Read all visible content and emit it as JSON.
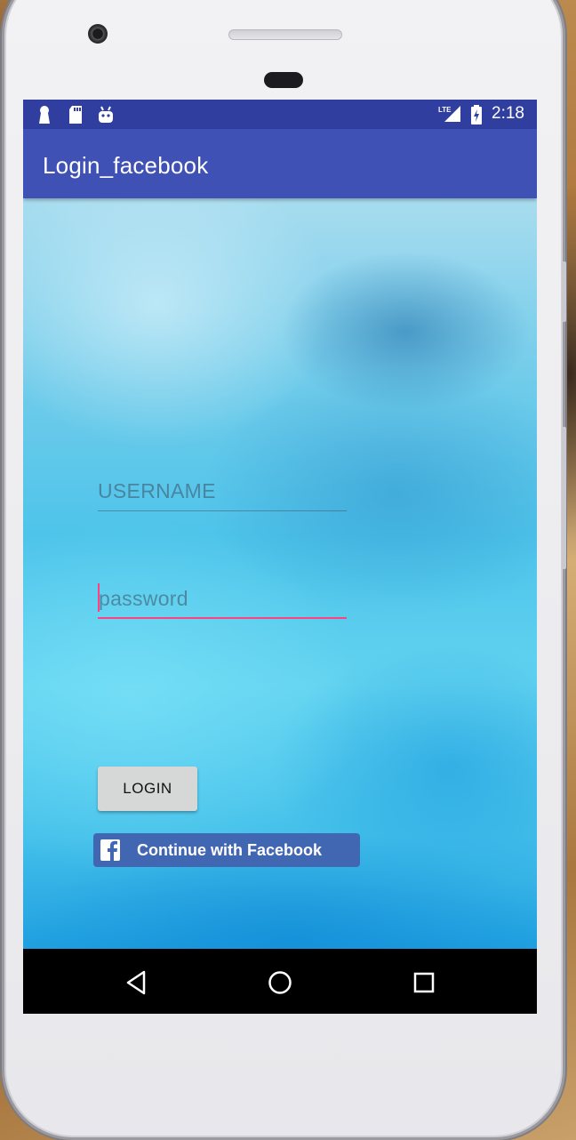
{
  "status_bar": {
    "time": "2:18",
    "network_label": "LTE",
    "icons": [
      "keyhole-icon",
      "sd-card-icon",
      "android-icon",
      "lte-signal-icon",
      "battery-charging-icon"
    ]
  },
  "app_bar": {
    "title": "Login_facebook"
  },
  "form": {
    "username_placeholder": "USERNAME",
    "password_placeholder": "password",
    "login_label": "LOGIN",
    "facebook_label": "Continue with Facebook"
  },
  "nav_bar": {
    "buttons": [
      "back-icon",
      "home-icon",
      "recents-icon"
    ]
  },
  "colors": {
    "status_bar": "#303f9f",
    "app_bar": "#3f51b5",
    "accent": "#ff4081",
    "facebook": "#4267b2",
    "login_button": "#d6d7d7"
  }
}
